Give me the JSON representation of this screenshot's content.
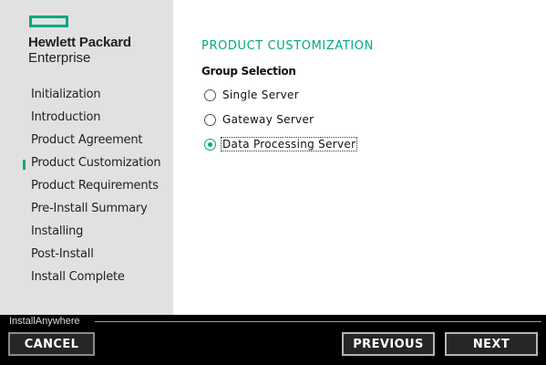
{
  "logo": {
    "line1": "Hewlett Packard",
    "line2": "Enterprise",
    "brand_color": "#01a982"
  },
  "steps": [
    {
      "label": "Initialization",
      "current": false
    },
    {
      "label": "Introduction",
      "current": false
    },
    {
      "label": "Product Agreement",
      "current": false
    },
    {
      "label": "Product Customization",
      "current": true
    },
    {
      "label": "Product Requirements",
      "current": false
    },
    {
      "label": "Pre-Install Summary",
      "current": false
    },
    {
      "label": "Installing",
      "current": false
    },
    {
      "label": "Post-Install",
      "current": false
    },
    {
      "label": "Install Complete",
      "current": false
    }
  ],
  "main": {
    "title": "PRODUCT CUSTOMIZATION",
    "group_label": "Group Selection",
    "options": [
      {
        "label": "Single Server",
        "selected": false
      },
      {
        "label": "Gateway Server",
        "selected": false
      },
      {
        "label": "Data Processing Server",
        "selected": true
      }
    ]
  },
  "footer": {
    "vendor": "InstallAnywhere",
    "cancel_label": "CANCEL",
    "previous_label": "PREVIOUS",
    "next_label": "NEXT"
  }
}
